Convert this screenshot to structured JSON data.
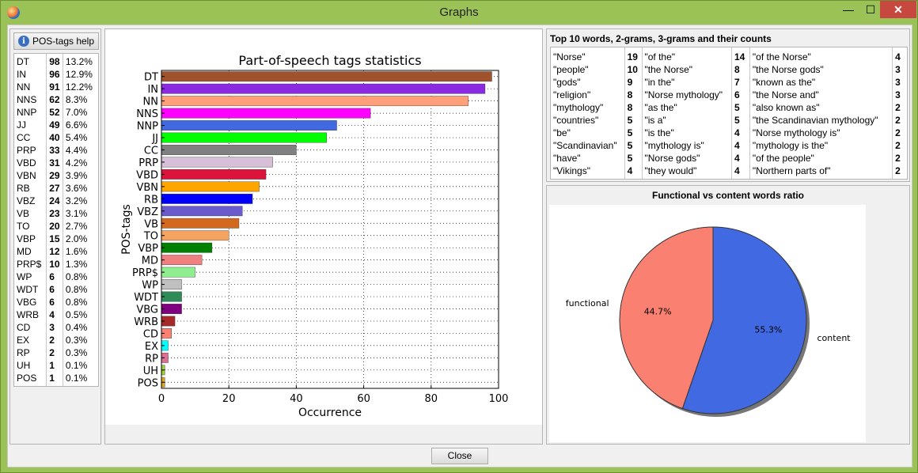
{
  "window": {
    "title": "Graphs",
    "minimize": "—",
    "maximize": "☐",
    "close": "✕"
  },
  "left_panel": {
    "help_button": "POS-tags help",
    "rows": [
      {
        "tag": "DT",
        "count": "98",
        "pct": "13.2%"
      },
      {
        "tag": "IN",
        "count": "96",
        "pct": "12.9%"
      },
      {
        "tag": "NN",
        "count": "91",
        "pct": "12.2%"
      },
      {
        "tag": "NNS",
        "count": "62",
        "pct": "8.3%"
      },
      {
        "tag": "NNP",
        "count": "52",
        "pct": "7.0%"
      },
      {
        "tag": "JJ",
        "count": "49",
        "pct": "6.6%"
      },
      {
        "tag": "CC",
        "count": "40",
        "pct": "5.4%"
      },
      {
        "tag": "PRP",
        "count": "33",
        "pct": "4.4%"
      },
      {
        "tag": "VBD",
        "count": "31",
        "pct": "4.2%"
      },
      {
        "tag": "VBN",
        "count": "29",
        "pct": "3.9%"
      },
      {
        "tag": "RB",
        "count": "27",
        "pct": "3.6%"
      },
      {
        "tag": "VBZ",
        "count": "24",
        "pct": "3.2%"
      },
      {
        "tag": "VB",
        "count": "23",
        "pct": "3.1%"
      },
      {
        "tag": "TO",
        "count": "20",
        "pct": "2.7%"
      },
      {
        "tag": "VBP",
        "count": "15",
        "pct": "2.0%"
      },
      {
        "tag": "MD",
        "count": "12",
        "pct": "1.6%"
      },
      {
        "tag": "PRP$",
        "count": "10",
        "pct": "1.3%"
      },
      {
        "tag": "WP",
        "count": "6",
        "pct": "0.8%"
      },
      {
        "tag": "WDT",
        "count": "6",
        "pct": "0.8%"
      },
      {
        "tag": "VBG",
        "count": "6",
        "pct": "0.8%"
      },
      {
        "tag": "WRB",
        "count": "4",
        "pct": "0.5%"
      },
      {
        "tag": "CD",
        "count": "3",
        "pct": "0.4%"
      },
      {
        "tag": "EX",
        "count": "2",
        "pct": "0.3%"
      },
      {
        "tag": "RP",
        "count": "2",
        "pct": "0.3%"
      },
      {
        "tag": "UH",
        "count": "1",
        "pct": "0.1%"
      },
      {
        "tag": "POS",
        "count": "1",
        "pct": "0.1%"
      }
    ]
  },
  "ngrams": {
    "title": "Top 10 words, 2-grams, 3-grams and their counts",
    "words": [
      {
        "t": "\"Norse\"",
        "c": "19"
      },
      {
        "t": "\"people\"",
        "c": "10"
      },
      {
        "t": "\"gods\"",
        "c": "9"
      },
      {
        "t": "\"religion\"",
        "c": "8"
      },
      {
        "t": "\"mythology\"",
        "c": "8"
      },
      {
        "t": "\"countries\"",
        "c": "5"
      },
      {
        "t": "\"be\"",
        "c": "5"
      },
      {
        "t": "\"Scandinavian\"",
        "c": "5"
      },
      {
        "t": "\"have\"",
        "c": "5"
      },
      {
        "t": "\"Vikings\"",
        "c": "4"
      }
    ],
    "bigrams": [
      {
        "t": "\"of the\"",
        "c": "14"
      },
      {
        "t": "\"the Norse\"",
        "c": "8"
      },
      {
        "t": "\"in the\"",
        "c": "7"
      },
      {
        "t": "\"Norse mythology\"",
        "c": "6"
      },
      {
        "t": "\"as the\"",
        "c": "5"
      },
      {
        "t": "\"is a\"",
        "c": "5"
      },
      {
        "t": "\"is the\"",
        "c": "4"
      },
      {
        "t": "\"mythology is\"",
        "c": "4"
      },
      {
        "t": "\"Norse gods\"",
        "c": "4"
      },
      {
        "t": "\"they would\"",
        "c": "4"
      }
    ],
    "trigrams": [
      {
        "t": "\"of the Norse\"",
        "c": "4"
      },
      {
        "t": "\"the Norse gods\"",
        "c": "3"
      },
      {
        "t": "\"known as the\"",
        "c": "3"
      },
      {
        "t": "\"the Norse and\"",
        "c": "3"
      },
      {
        "t": "\"also known as\"",
        "c": "2"
      },
      {
        "t": "\"the Scandinavian mythology\"",
        "c": "2"
      },
      {
        "t": "\"Norse mythology is\"",
        "c": "2"
      },
      {
        "t": "\"mythology is the\"",
        "c": "2"
      },
      {
        "t": "\"of the people\"",
        "c": "2"
      },
      {
        "t": "\"Northern parts of\"",
        "c": "2"
      }
    ]
  },
  "close_button": "Close",
  "chart_data": [
    {
      "type": "bar",
      "orientation": "horizontal",
      "title": "Part-of-speech tags statistics",
      "xlabel": "Occurrence",
      "ylabel": "POS-tags",
      "xlim": [
        0,
        100
      ],
      "xticks": [
        "0",
        "20",
        "40",
        "60",
        "80",
        "100"
      ],
      "grid": true,
      "categories": [
        "DT",
        "IN",
        "NN",
        "NNS",
        "NNP",
        "JJ",
        "CC",
        "PRP",
        "VBD",
        "VBN",
        "RB",
        "VBZ",
        "VB",
        "TO",
        "VBP",
        "MD",
        "PRP$",
        "WP",
        "WDT",
        "VBG",
        "WRB",
        "CD",
        "EX",
        "RP",
        "UH",
        "POS"
      ],
      "values": [
        98,
        96,
        91,
        62,
        52,
        49,
        40,
        33,
        31,
        29,
        27,
        24,
        23,
        20,
        15,
        12,
        10,
        6,
        6,
        6,
        4,
        3,
        2,
        2,
        1,
        1
      ],
      "colors": [
        "#a0522d",
        "#8a2be2",
        "#ffa07a",
        "#ff00ff",
        "#4169e1",
        "#00ff00",
        "#808080",
        "#d8bfd8",
        "#dc143c",
        "#ffa500",
        "#0000ff",
        "#6a5acd",
        "#d2691e",
        "#f4a460",
        "#008000",
        "#f08080",
        "#90ee90",
        "#c0c0c0",
        "#2e8b57",
        "#800080",
        "#a52a2a",
        "#fa8072",
        "#00ffff",
        "#db7093",
        "#9acd32",
        "#daa520"
      ]
    },
    {
      "type": "pie",
      "title": "Functional vs content words ratio",
      "labels": [
        "functional",
        "content"
      ],
      "values": [
        44.7,
        55.3
      ],
      "value_labels": [
        "44.7%",
        "55.3%"
      ],
      "colors": [
        "#fa8072",
        "#4169e1"
      ]
    }
  ]
}
